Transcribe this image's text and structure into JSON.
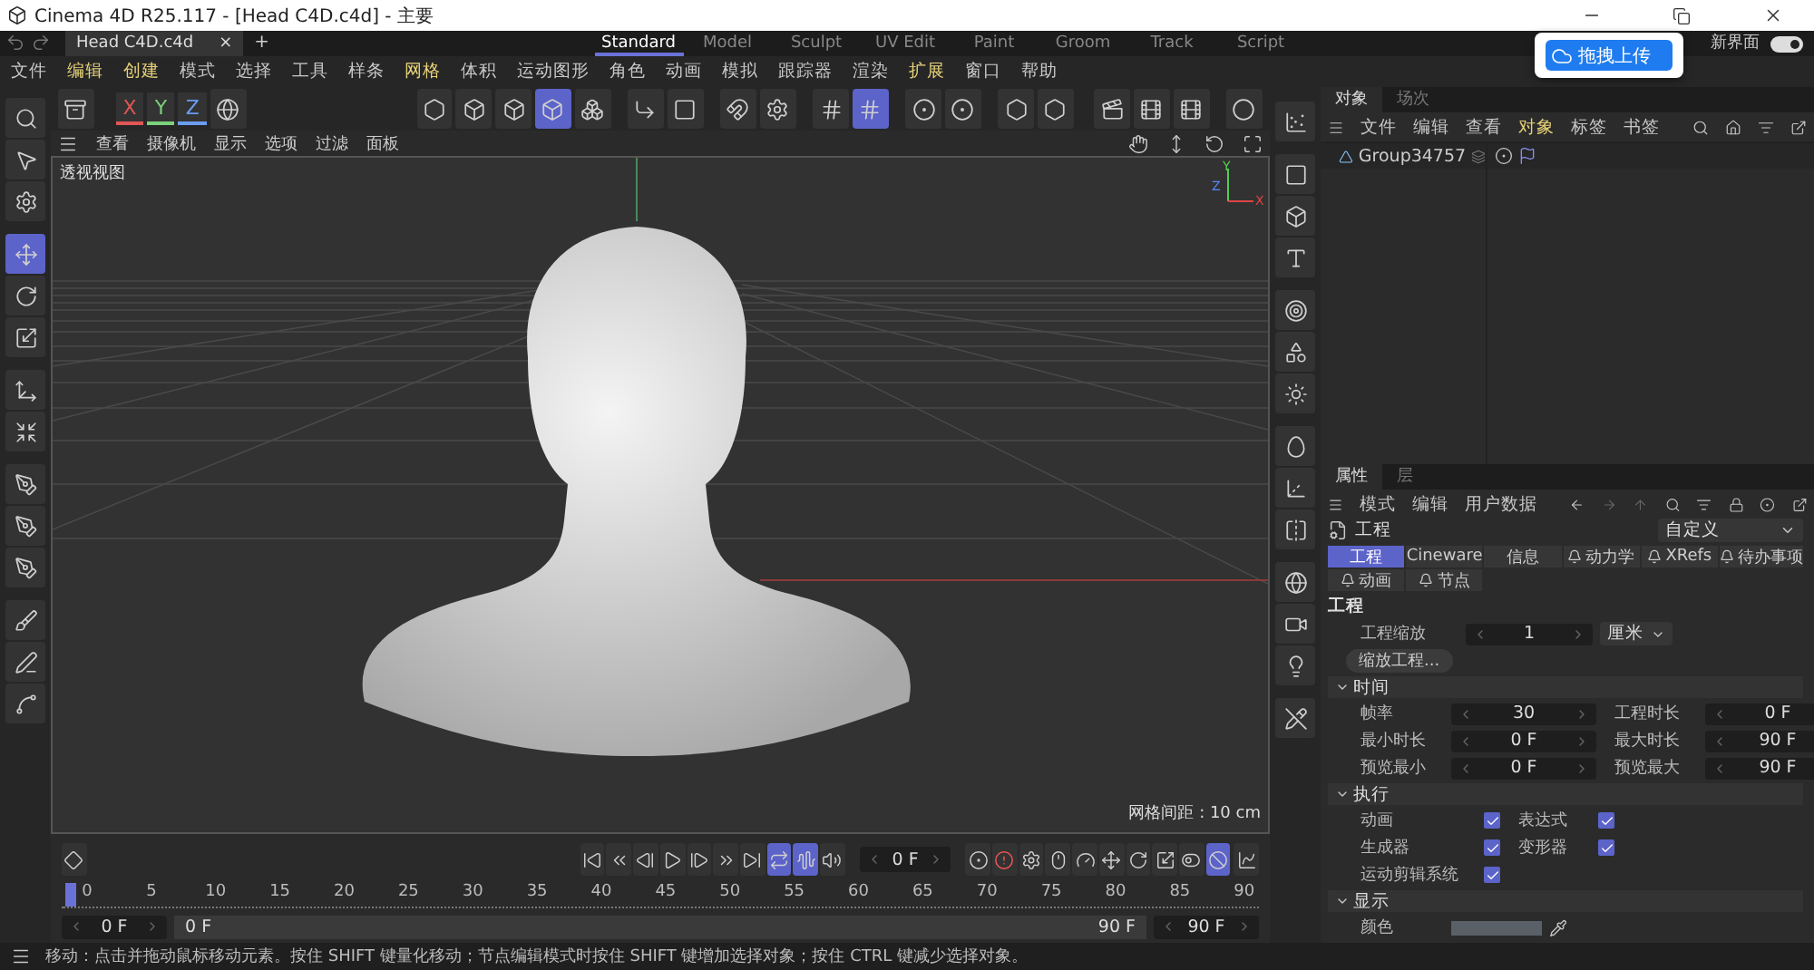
{
  "window": {
    "title": "Cinema 4D R25.117 - [Head C4D.c4d] - 主要"
  },
  "document_tab": {
    "label": "Head C4D.c4d",
    "close": "×",
    "add": "+"
  },
  "layouts": [
    {
      "label": "Standard",
      "selected": true
    },
    {
      "label": "Model",
      "selected": false
    },
    {
      "label": "Sculpt",
      "selected": false
    },
    {
      "label": "UV Edit",
      "selected": false
    },
    {
      "label": "Paint",
      "selected": false
    },
    {
      "label": "Groom",
      "selected": false
    },
    {
      "label": "Track",
      "selected": false
    },
    {
      "label": "Script",
      "selected": false
    }
  ],
  "new_interface": {
    "label": "新界面",
    "on": true
  },
  "upload_popup": {
    "label": "拖拽上传"
  },
  "menu": [
    {
      "label": "文件",
      "highlighted": false
    },
    {
      "label": "编辑",
      "highlighted": true
    },
    {
      "label": "创建",
      "highlighted": true
    },
    {
      "label": "模式",
      "highlighted": false
    },
    {
      "label": "选择",
      "highlighted": false
    },
    {
      "label": "工具",
      "highlighted": false
    },
    {
      "label": "样条",
      "highlighted": false
    },
    {
      "label": "网格",
      "highlighted": true
    },
    {
      "label": "体积",
      "highlighted": false
    },
    {
      "label": "运动图形",
      "highlighted": false
    },
    {
      "label": "角色",
      "highlighted": false
    },
    {
      "label": "动画",
      "highlighted": false
    },
    {
      "label": "模拟",
      "highlighted": false
    },
    {
      "label": "跟踪器",
      "highlighted": false
    },
    {
      "label": "渲染",
      "highlighted": false
    },
    {
      "label": "扩展",
      "highlighted": true
    },
    {
      "label": "窗口",
      "highlighted": false
    },
    {
      "label": "帮助",
      "highlighted": false
    }
  ],
  "toolbar": {
    "axes": [
      "X",
      "Y",
      "Z"
    ],
    "tools": [
      {
        "selected": false
      },
      {
        "selected": false
      },
      {
        "selected": false
      },
      {
        "selected": true
      },
      {
        "selected": false
      },
      {
        "selected": false
      },
      {
        "selected": false
      },
      {
        "selected": false
      },
      {
        "selected": false
      },
      {
        "selected": false
      },
      {
        "selected": true
      },
      {
        "selected": false
      },
      {
        "selected": false
      },
      {
        "selected": false
      },
      {
        "selected": false
      },
      {
        "selected": false
      },
      {
        "selected": false
      },
      {
        "selected": false
      },
      {
        "selected": false
      }
    ]
  },
  "left_tools": [
    {
      "selected": false
    },
    {
      "selected": false
    },
    {
      "selected": false
    },
    {
      "selected": true
    },
    {
      "selected": false
    },
    {
      "selected": false
    },
    {
      "selected": false
    },
    {
      "selected": false
    },
    {
      "selected": false
    },
    {
      "selected": false
    },
    {
      "selected": false
    },
    {
      "selected": false
    },
    {
      "selected": false
    },
    {
      "selected": false
    }
  ],
  "viewport": {
    "menu": [
      "查看",
      "摄像机",
      "显示",
      "选项",
      "过滤",
      "面板"
    ],
    "label": "透视视图",
    "axis_labels": [
      "Y",
      "Z",
      "X"
    ],
    "grid_info": "网格间距 : 10 cm"
  },
  "timeline": {
    "transport": [
      {
        "selected": false
      },
      {
        "selected": false
      },
      {
        "selected": false
      },
      {
        "selected": false
      },
      {
        "selected": false
      },
      {
        "selected": false
      },
      {
        "selected": false
      },
      {
        "selected": true
      },
      {
        "selected": true
      },
      {
        "selected": false
      }
    ],
    "current_frame": "0 F",
    "keys": [
      {
        "selected": false
      },
      {
        "selected": false
      },
      {
        "selected": false
      },
      {
        "selected": false
      },
      {
        "selected": false
      },
      {
        "selected": false
      },
      {
        "selected": false
      },
      {
        "selected": false
      },
      {
        "selected": false
      },
      {
        "selected": true
      }
    ],
    "ruler": [
      "0",
      "5",
      "10",
      "15",
      "20",
      "25",
      "30",
      "35",
      "40",
      "45",
      "50",
      "55",
      "60",
      "65",
      "70",
      "75",
      "80",
      "85",
      "90"
    ],
    "start": "0 F",
    "range_start": "0 F",
    "range_end": "90 F",
    "end": "90 F"
  },
  "status_bar": "移动：点击并拖动鼠标移动元素。按住 SHIFT 键量化移动；节点编辑模式时按住 SHIFT 键增加选择对象；按住 CTRL 键减少选择对象。",
  "object_manager": {
    "tabs": [
      {
        "label": "对象",
        "selected": true
      },
      {
        "label": "场次",
        "selected": false
      }
    ],
    "menu": [
      {
        "label": "文件",
        "highlighted": false
      },
      {
        "label": "编辑",
        "highlighted": false
      },
      {
        "label": "查看",
        "highlighted": false
      },
      {
        "label": "对象",
        "highlighted": true
      },
      {
        "label": "标签",
        "highlighted": false
      },
      {
        "label": "书签",
        "highlighted": false
      }
    ],
    "objects": [
      {
        "name": "Group34757"
      }
    ]
  },
  "attributes": {
    "tabs": [
      {
        "label": "属性",
        "selected": true
      },
      {
        "label": "层",
        "selected": false
      }
    ],
    "menu": [
      "模式",
      "编辑",
      "用户数据"
    ],
    "title": "工程",
    "preset": "自定义",
    "pages": [
      {
        "label": "工程",
        "selected": true,
        "locked": false
      },
      {
        "label": "Cineware",
        "selected": false,
        "locked": false
      },
      {
        "label": "信息",
        "selected": false,
        "locked": false
      },
      {
        "label": "动力学",
        "selected": false,
        "locked": true
      },
      {
        "label": "XRefs",
        "selected": false,
        "locked": true
      },
      {
        "label": "待办事项",
        "selected": false,
        "locked": true
      },
      {
        "label": "动画",
        "selected": false,
        "locked": true
      },
      {
        "label": "节点",
        "selected": false,
        "locked": true
      }
    ],
    "section": "工程",
    "scale": {
      "label": "工程缩放",
      "value": "1",
      "unit": "厘米"
    },
    "scale_button": "缩放工程...",
    "groups": [
      {
        "title": "时间",
        "expanded": true,
        "kind": "fields",
        "fields": [
          {
            "label": "帧率",
            "value": "30"
          },
          {
            "label": "工程时长",
            "value": "0 F"
          },
          {
            "label": "最小时长",
            "value": "0 F"
          },
          {
            "label": "最大时长",
            "value": "90 F"
          },
          {
            "label": "预览最小",
            "value": "0 F"
          },
          {
            "label": "预览最大",
            "value": "90 F"
          }
        ]
      },
      {
        "title": "执行",
        "expanded": true,
        "kind": "checks",
        "fields": [
          {
            "label": "动画",
            "checked": true
          },
          {
            "label": "表达式",
            "checked": true
          },
          {
            "label": "生成器",
            "checked": true
          },
          {
            "label": "变形器",
            "checked": true
          },
          {
            "label": "运动剪辑系统",
            "checked": true
          }
        ]
      },
      {
        "title": "显示",
        "expanded": true,
        "kind": "color",
        "fields": [
          {
            "label": "颜色",
            "color": "#5a6068"
          }
        ]
      }
    ]
  }
}
